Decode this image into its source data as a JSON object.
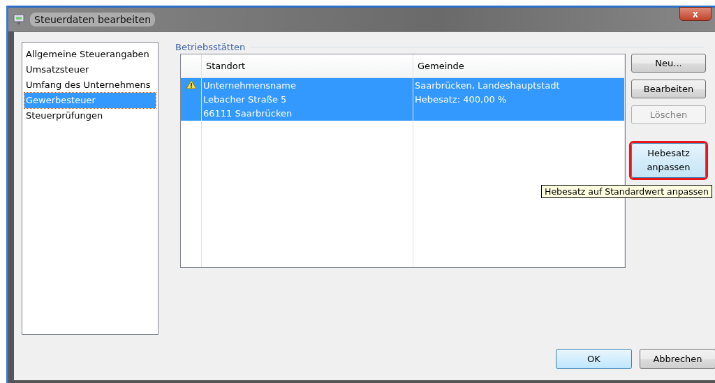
{
  "window": {
    "title": "Steuerdaten bearbeiten",
    "close_label": "x"
  },
  "sidebar": {
    "items": [
      {
        "label": "Allgemeine Steuerangaben",
        "selected": false
      },
      {
        "label": "Umsatzsteuer",
        "selected": false
      },
      {
        "label": "Umfang des Unternehmens",
        "selected": false
      },
      {
        "label": "Gewerbesteuer",
        "selected": true
      },
      {
        "label": "Steuerprüfungen",
        "selected": false
      }
    ]
  },
  "group": {
    "title": "Betriebsstätten"
  },
  "table": {
    "columns": [
      "Standort",
      "Gemeinde"
    ],
    "rows": [
      {
        "selected": true,
        "warning": true,
        "cells": [
          [
            "Unternehmensname",
            "Lebacher Straße 5",
            "66111 Saarbrücken"
          ],
          [
            "Saarbrücken, Landeshauptstadt",
            "Hebesatz: 400,00 %"
          ]
        ]
      }
    ]
  },
  "side_buttons": [
    {
      "label": "Neu...",
      "disabled": false,
      "highlighted": false
    },
    {
      "label": "Bearbeiten",
      "disabled": false,
      "highlighted": false
    },
    {
      "label": "Löschen",
      "disabled": true,
      "highlighted": false
    },
    {
      "label": "Hebesatz anpassen",
      "disabled": false,
      "highlighted": true
    }
  ],
  "tooltip": "Hebesatz auf Standardwert anpassen",
  "footer_buttons": [
    {
      "label": "OK",
      "default": true
    },
    {
      "label": "Abbrechen",
      "default": false
    }
  ]
}
